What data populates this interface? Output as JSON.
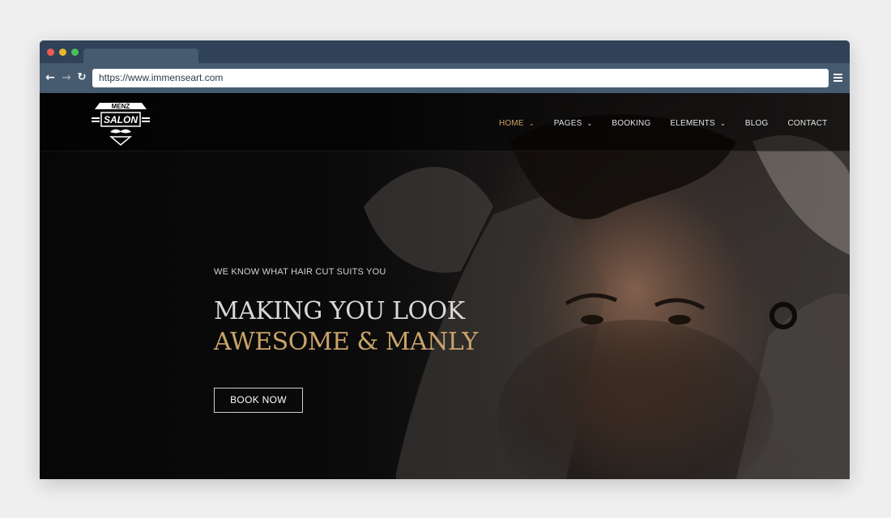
{
  "browser": {
    "url": "https://www.immenseart.com",
    "back_icon": "arrow-left-icon",
    "forward_icon": "arrow-right-icon",
    "reload_icon": "reload-icon",
    "menu_icon": "hamburger-menu-icon"
  },
  "site": {
    "logo_icon": "menz-salon-logo-icon",
    "nav": [
      {
        "label": "HOME",
        "active": true,
        "dropdown": true
      },
      {
        "label": "PAGES",
        "active": false,
        "dropdown": true
      },
      {
        "label": "BOOKING",
        "active": false,
        "dropdown": false
      },
      {
        "label": "ELEMENTS",
        "active": false,
        "dropdown": true
      },
      {
        "label": "BLOG",
        "active": false,
        "dropdown": false
      },
      {
        "label": "CONTACT",
        "active": false,
        "dropdown": false
      }
    ]
  },
  "hero": {
    "kicker": "WE KNOW WHAT HAIR CUT SUITS YOU",
    "headline_line1": "MAKING YOU LOOK",
    "headline_line2": "AWESOME & MANLY",
    "cta_label": "BOOK NOW",
    "image_icon": "bearded-man-hero-image"
  },
  "colors": {
    "accent_gold": "#c9a36a",
    "browser_chrome": "#465b70",
    "titlebar": "#2f4257",
    "page_bg": "#0a0a0a"
  }
}
